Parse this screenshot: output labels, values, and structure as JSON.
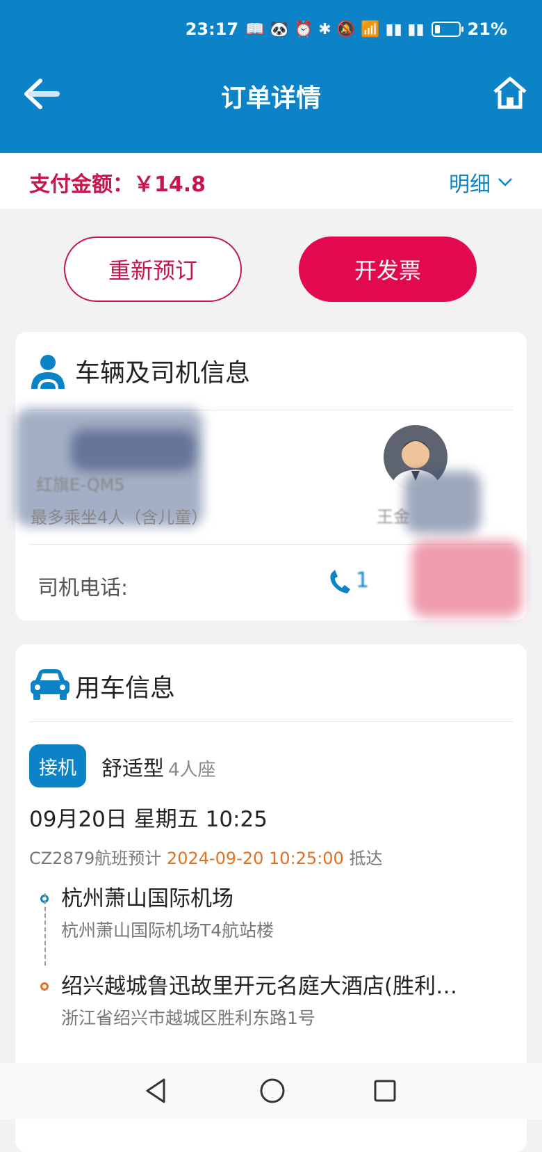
{
  "status": {
    "time": "23:17",
    "battery": "21%",
    "battery_level": 0.21
  },
  "header": {
    "title": "订单详情"
  },
  "payment": {
    "label": "支付金额：",
    "amount": "￥14.8",
    "detail_label": "明细"
  },
  "actions": {
    "rebook_label": "重新预订",
    "invoice_label": "开发票"
  },
  "vehicle_card": {
    "title": "车辆及司机信息",
    "car_model": "红旗E-QM5",
    "seats": "最多乘坐4人（含儿童）",
    "driver_name": "王金",
    "phone_label": "司机电话:",
    "phone_number": "1"
  },
  "ride_card": {
    "title": "用车信息",
    "service_tag": "接机",
    "car_type": "舒适型",
    "car_seats": "4人座",
    "datetime": "09月20日 星期五 10:25",
    "flight_prefix": "CZ2879航班预计",
    "flight_time": "2024-09-20 10:25:00",
    "flight_suffix": "抵达",
    "pickup_name": "杭州萧山国际机场",
    "pickup_sub": "杭州萧山国际机场T4航站楼",
    "dropoff_name": "绍兴越城鲁迅故里开元名庭大酒店(胜利…",
    "dropoff_sub": "浙江省绍兴市越城区胜利东路1号"
  },
  "colors": {
    "primary": "#0b83c6",
    "accent": "#e2094f",
    "highlight": "#e36f20"
  },
  "icons": [
    "back-arrow-icon",
    "home-icon",
    "driver-icon",
    "car-icon",
    "chevron-down-icon",
    "phone-icon",
    "nav-back-icon",
    "nav-home-icon",
    "nav-recents-icon"
  ]
}
